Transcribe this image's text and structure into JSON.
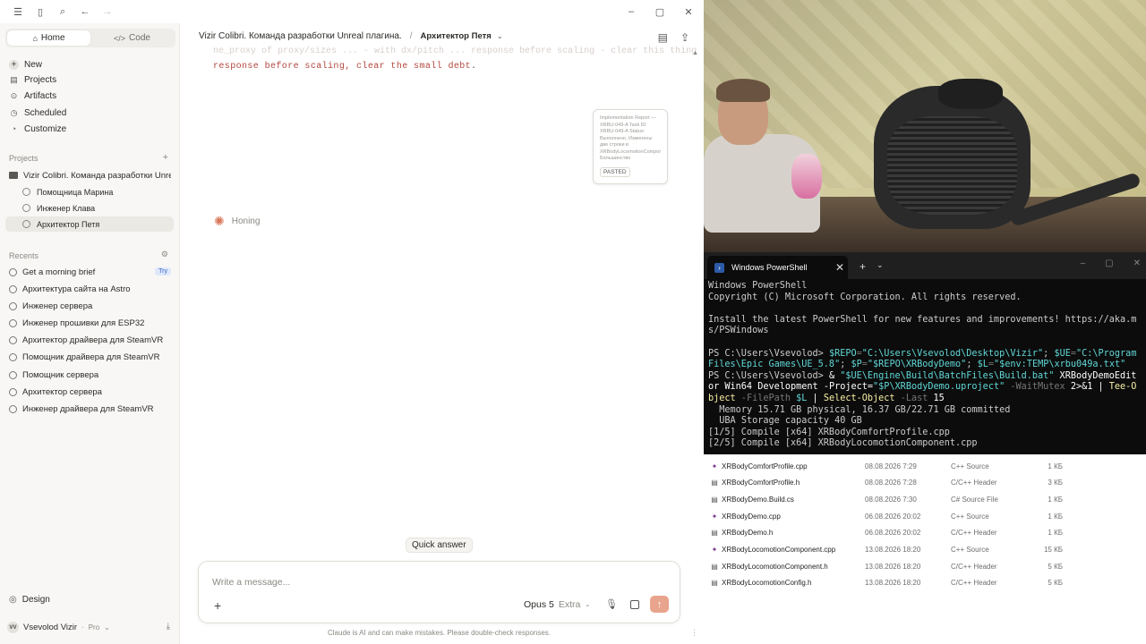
{
  "sidebar": {
    "modes": [
      {
        "label": "Home"
      },
      {
        "label": "Code"
      }
    ],
    "nav": [
      {
        "label": "New"
      },
      {
        "label": "Projects"
      },
      {
        "label": "Artifacts"
      },
      {
        "label": "Scheduled"
      },
      {
        "label": "Customize"
      }
    ],
    "projects_title": "Projects",
    "project_name": "Vizir Colibri. Команда разработки Unreal",
    "project_chats": [
      {
        "label": "Помощница Марина"
      },
      {
        "label": "Инженер Клава"
      },
      {
        "label": "Архитектор Петя"
      }
    ],
    "recents_title": "Recents",
    "recents": [
      {
        "label": "Get a morning brief",
        "badge": "Try"
      },
      {
        "label": "Архитектура сайта на Astro"
      },
      {
        "label": "Инженер сервера"
      },
      {
        "label": "Инженер прошивки для ESP32"
      },
      {
        "label": "Архитектор драйвера для SteamVR"
      },
      {
        "label": "Помощник драйвера для SteamVR"
      },
      {
        "label": "Помощник сервера"
      },
      {
        "label": "Архитектор сервера"
      },
      {
        "label": "Инженер драйвера для SteamVR"
      }
    ],
    "design_label": "Design",
    "user": {
      "initials": "VV",
      "name": "Vsevolod Vizir",
      "plan": "Pro"
    }
  },
  "main": {
    "breadcrumb_project": "Vizir Colibri. Команда разработки Unreal плагина.",
    "breadcrumb_chat": "Архитектор Петя",
    "code_fade": "ne_proxy of proxy/sizes ... - with dx/pitch ... response before scaling - clear this thing - the test",
    "code_line": "response before scaling, clear the small debt",
    "code_line_end": ".",
    "pasted_snippet": "Implementation Report — XRBU-049-A Task ID: XRBU-049-A Status: Выполнено. Изменены две строки в XRBodyLocomotionComponent.h. Большинство",
    "pasted_label": "PASTED",
    "status": "Honing",
    "quick_answer": "Quick answer",
    "composer_placeholder": "Write a message...",
    "model": "Opus 5",
    "effort": "Extra",
    "disclaimer": "Claude is AI and can make mistakes. Please double-check responses."
  },
  "terminal": {
    "tab_title": "Windows PowerShell",
    "lines": {
      "l1": "Windows PowerShell",
      "l2": "Copyright (C) Microsoft Corporation. All rights reserved.",
      "l3": "Install the latest PowerShell for new features and improvements! https://aka.ms/PSWindows",
      "p1": "PS C:\\Users\\Vsevolod> ",
      "c1a": "$REPO",
      "c1b": "=",
      "c1c": "\"C:\\Users\\Vsevolod\\Desktop\\Vizir\"",
      "c1d": "; ",
      "c1e": "$UE",
      "c1f": "=",
      "c1g": "\"C:\\Program Files\\Epic Games\\UE_5.8\"",
      "c1h": "; ",
      "c1i": "$P",
      "c1j": "=",
      "c1k": "\"$REPO\\XRBodyDemo\"",
      "c1l": "; ",
      "c1m": "$L",
      "c1n": "=",
      "c1o": "\"$env:TEMP\\xrbu049a.txt\"",
      "p2": "PS C:\\Users\\Vsevolod> ",
      "c2a": "& ",
      "c2b": "\"$UE\\Engine\\Build\\BatchFiles\\Build.bat\"",
      "c2c": " XRBodyDemoEditor Win64 Development ",
      "c2d": "-Project=",
      "c2e": "\"$P\\XRBodyDemo.uproject\"",
      "c2f": " -WaitMutex ",
      "c2g": "2>&1 | ",
      "c2h": "Tee-Object",
      "c2i": " -FilePath ",
      "c2j": "$L",
      "c2k": " | ",
      "c2l": "Select-Object",
      "c2m": " -Last ",
      "c2n": "15",
      "o1": "  Memory 15.71 GB physical, 16.37 GB/22.71 GB committed",
      "o2": "  UBA Storage capacity 40 GB",
      "o3": "[1/5] Compile [x64] XRBodyComfortProfile.cpp",
      "o4": "[2/5] Compile [x64] XRBodyLocomotionComponent.cpp"
    }
  },
  "files": [
    {
      "name": "XRBodyComfortProfile.cpp",
      "date": "08.08.2026 7:29",
      "type": "C++ Source",
      "size": "1 КБ",
      "kind": "cpp"
    },
    {
      "name": "XRBodyComfortProfile.h",
      "date": "08.08.2026 7:28",
      "type": "C/C++ Header",
      "size": "3 КБ",
      "kind": "h"
    },
    {
      "name": "XRBodyDemo.Build.cs",
      "date": "08.08.2026 7:30",
      "type": "C# Source File",
      "size": "1 КБ",
      "kind": "cs"
    },
    {
      "name": "XRBodyDemo.cpp",
      "date": "06.08.2026 20:02",
      "type": "C++ Source",
      "size": "1 КБ",
      "kind": "cpp"
    },
    {
      "name": "XRBodyDemo.h",
      "date": "06.08.2026 20:02",
      "type": "C/C++ Header",
      "size": "1 КБ",
      "kind": "h"
    },
    {
      "name": "XRBodyLocomotionComponent.cpp",
      "date": "13.08.2026 18:20",
      "type": "C++ Source",
      "size": "15 КБ",
      "kind": "cpp"
    },
    {
      "name": "XRBodyLocomotionComponent.h",
      "date": "13.08.2026 18:20",
      "type": "C/C++ Header",
      "size": "5 КБ",
      "kind": "h"
    },
    {
      "name": "XRBodyLocomotionConfig.h",
      "date": "13.08.2026 18:20",
      "type": "C/C++ Header",
      "size": "5 КБ",
      "kind": "h"
    }
  ],
  "colors": {
    "accent": "#d9775a",
    "send": "#e8a48c",
    "code": "#b2473d",
    "terminal_bg": "#0c0c0c",
    "terminal_yellow": "#f9f1a5"
  },
  "icons": [
    "menu-icon",
    "sidebar-toggle-icon",
    "search-icon",
    "back-icon",
    "forward-icon",
    "minimize-icon",
    "maximize-icon",
    "close-icon",
    "home-icon",
    "code-icon",
    "plus-icon",
    "projects-icon",
    "artifacts-icon",
    "scheduled-icon",
    "customize-icon",
    "folder-icon",
    "chat-icon",
    "settings-icon",
    "design-icon",
    "download-icon",
    "document-icon",
    "share-icon",
    "spark-icon",
    "mic-icon",
    "send-icon"
  ]
}
